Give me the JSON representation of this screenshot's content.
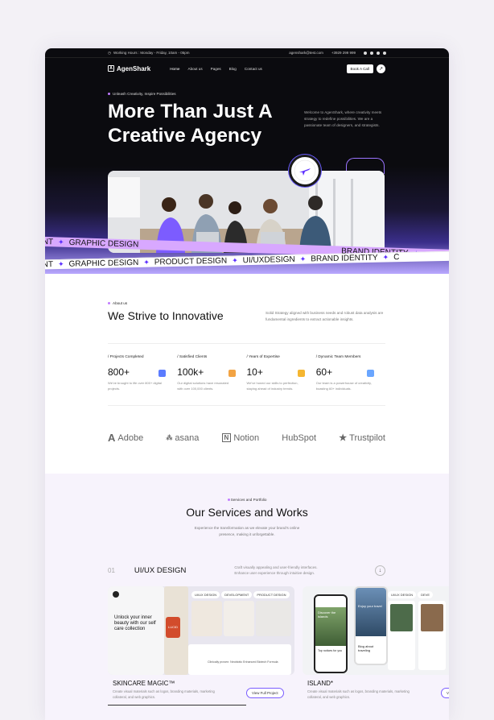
{
  "topbar": {
    "hours": "Working Hours : Monday - Friday, 10am - 05pm",
    "email": "agenshark@test.com",
    "phone": "+3929 299 999"
  },
  "nav": {
    "brand": "AgenShark",
    "items": [
      "Home",
      "About us",
      "Pages",
      "Blog",
      "Contact us"
    ],
    "cta": "Book A Call"
  },
  "hero": {
    "tagline": "Unleash Creativity, Inspire Possibilities",
    "title": "More Than Just A Creative Agency",
    "description": "Welcome to AgenShark, where creativity meets strategy to redefine possibilities. We are a passionate team of designers, and strategists.",
    "badge_text": "BOOK YOUR WEBSITE NOW"
  },
  "ribbon": {
    "top": [
      "ENT",
      "GRAPHIC DESIGN",
      "BRAND IDENTITY"
    ],
    "bottom": [
      "ENT",
      "GRAPHIC DESIGN",
      "PRODUCT DESIGN",
      "UI/UXDESIGN",
      "BRAND IDENTITY",
      "C"
    ]
  },
  "about": {
    "tag": "About us",
    "title": "We Strive to Innovative",
    "description": "Solid Strategy aligned with business needs and robust data analysis are fundamental ingredients to extract actionable insights.",
    "stats": [
      {
        "label": "/ Projects Completed",
        "value": "800+",
        "desc": "We've brought to life over 800+ digital projects.",
        "icon": "rocket-icon",
        "color": "#5b7cff"
      },
      {
        "label": "/ Satisfied Clients",
        "value": "100k+",
        "desc": "Our digital solutions have resonated with over 100,000 clients.",
        "icon": "person-icon",
        "color": "#f2a343"
      },
      {
        "label": "/ Years of Expertise",
        "value": "10+",
        "desc": "We've honed our skills to perfection, staying ahead of industry trends.",
        "icon": "calendar-icon",
        "color": "#f5b631"
      },
      {
        "label": "/ Dynamic Team Members",
        "value": "60+",
        "desc": "Our team is a powerhouse of creativity, boasting 60+ individuals.",
        "icon": "team-icon",
        "color": "#6aa6ff"
      }
    ]
  },
  "clients": [
    "Adobe",
    "asana",
    "Notion",
    "HubSpot",
    "Trustpilot"
  ],
  "services": {
    "tag": "Services and Portfolio",
    "title": "Our Services and Works",
    "description": "Experience the transformation as we elevate your brand's online presence, making it unforgettable.",
    "row": {
      "number": "01",
      "name": "UI/UX DESIGN",
      "desc": "Craft visually appealing and user-friendly interfaces. Enhance user experience through intuitive design."
    },
    "cards": [
      {
        "title": "SKINCARE MAGIC™",
        "desc": "Create visual materials such as logos, branding materials, marketing collateral, and web graphics.",
        "button": "View Full Project",
        "tags": [
          "UI/UX DESIGN",
          "DEVELOPMENT",
          "PRODUCT DESIGN"
        ],
        "headline": "Unlock your inner beauty with our self care collection",
        "product_label": "LUCID",
        "mini_caption": "Clinically proven: Neobiotic Enhanced Biotech Formula"
      },
      {
        "title": "ISLAND*",
        "desc": "Create visual materials such as logos, branding materials, marketing collateral, and web graphics.",
        "button": "V",
        "tags": [
          "UI/UX DESIGN",
          "DEVE"
        ],
        "headline": "Discover the islands",
        "screen_texts": [
          "Enjoy your travel",
          "Top notices for you",
          "Blog about traveling"
        ]
      }
    ]
  }
}
